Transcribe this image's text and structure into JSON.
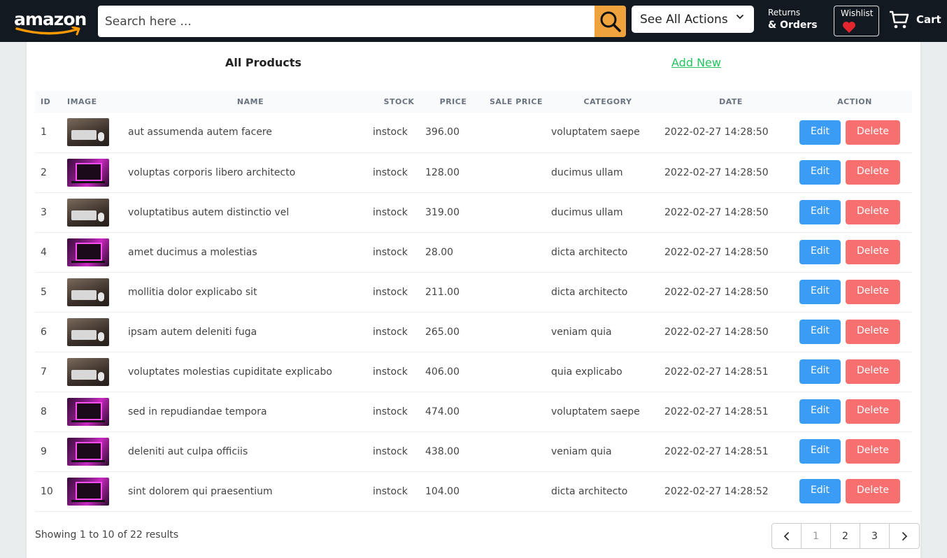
{
  "header": {
    "logo_text": "amazon",
    "search_placeholder": "Search here ...",
    "actions_label": "See All Actions",
    "returns_line1": "Returns",
    "returns_line2": "& Orders",
    "wishlist_label": "Wishlist",
    "cart_label": "Cart"
  },
  "page": {
    "title": "All Products",
    "add_new": "Add New"
  },
  "table": {
    "columns": [
      "ID",
      "IMAGE",
      "NAME",
      "STOCK",
      "PRICE",
      "SALE PRICE",
      "CATEGORY",
      "DATE",
      "ACTION"
    ],
    "edit_label": "Edit",
    "delete_label": "Delete",
    "rows": [
      {
        "id": "1",
        "image": "keyboard",
        "name": "aut assumenda autem facere",
        "stock": "instock",
        "price": "396.00",
        "sale": "",
        "category": "voluptatem saepe",
        "date": "2022-02-27 14:28:50"
      },
      {
        "id": "2",
        "image": "pc",
        "name": "voluptas corporis libero architecto",
        "stock": "instock",
        "price": "128.00",
        "sale": "",
        "category": "ducimus ullam",
        "date": "2022-02-27 14:28:50"
      },
      {
        "id": "3",
        "image": "keyboard",
        "name": "voluptatibus autem distinctio vel",
        "stock": "instock",
        "price": "319.00",
        "sale": "",
        "category": "ducimus ullam",
        "date": "2022-02-27 14:28:50"
      },
      {
        "id": "4",
        "image": "pc",
        "name": "amet ducimus a molestias",
        "stock": "instock",
        "price": "28.00",
        "sale": "",
        "category": "dicta architecto",
        "date": "2022-02-27 14:28:50"
      },
      {
        "id": "5",
        "image": "keyboard",
        "name": "mollitia dolor explicabo sit",
        "stock": "instock",
        "price": "211.00",
        "sale": "",
        "category": "dicta architecto",
        "date": "2022-02-27 14:28:50"
      },
      {
        "id": "6",
        "image": "keyboard",
        "name": "ipsam autem deleniti fuga",
        "stock": "instock",
        "price": "265.00",
        "sale": "",
        "category": "veniam quia",
        "date": "2022-02-27 14:28:50"
      },
      {
        "id": "7",
        "image": "keyboard",
        "name": "voluptates molestias cupiditate explicabo",
        "stock": "instock",
        "price": "406.00",
        "sale": "",
        "category": "quia explicabo",
        "date": "2022-02-27 14:28:51"
      },
      {
        "id": "8",
        "image": "pc",
        "name": "sed in repudiandae tempora",
        "stock": "instock",
        "price": "474.00",
        "sale": "",
        "category": "voluptatem saepe",
        "date": "2022-02-27 14:28:51"
      },
      {
        "id": "9",
        "image": "pc",
        "name": "deleniti aut culpa officiis",
        "stock": "instock",
        "price": "438.00",
        "sale": "",
        "category": "veniam quia",
        "date": "2022-02-27 14:28:51"
      },
      {
        "id": "10",
        "image": "pc",
        "name": "sint dolorem qui praesentium",
        "stock": "instock",
        "price": "104.00",
        "sale": "",
        "category": "dicta architecto",
        "date": "2022-02-27 14:28:52"
      }
    ]
  },
  "footer": {
    "showing": "Showing 1 to 10 of 22 results",
    "pages": [
      "1",
      "2",
      "3"
    ],
    "current_page": "1"
  },
  "colors": {
    "header_bg": "#131921",
    "search_button": "#f0a23d",
    "edit_button": "#3b9cf5",
    "delete_button": "#f76f6f",
    "add_new_link": "#22c55e"
  }
}
